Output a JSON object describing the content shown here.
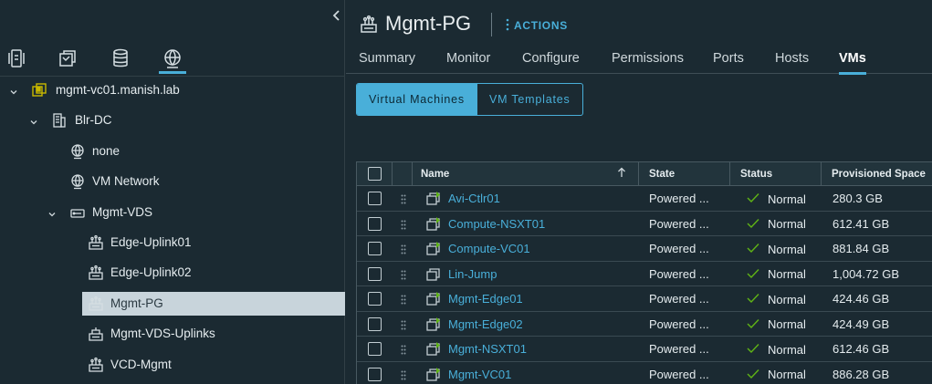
{
  "navigator": {
    "collapse_icon": "chevron-left-icon",
    "view_icons": [
      "hosts-clusters-icon",
      "vms-templates-icon",
      "storage-icon",
      "networking-icon"
    ],
    "active_view": "networking-icon",
    "tree": [
      {
        "label": "mgmt-vc01.manish.lab",
        "icon": "vcenter-icon",
        "expanded": true
      },
      {
        "label": "Blr-DC",
        "icon": "datacenter-icon",
        "expanded": true
      },
      {
        "label": "none",
        "icon": "network-icon"
      },
      {
        "label": "VM Network",
        "icon": "network-icon"
      },
      {
        "label": "Mgmt-VDS",
        "icon": "vds-icon",
        "expanded": true
      },
      {
        "label": "Edge-Uplink01",
        "icon": "portgroup-icon"
      },
      {
        "label": "Edge-Uplink02",
        "icon": "portgroup-icon"
      },
      {
        "label": "Mgmt-PG",
        "icon": "portgroup-icon",
        "selected": true
      },
      {
        "label": "Mgmt-VDS-Uplinks",
        "icon": "uplink-portgroup-icon"
      },
      {
        "label": "VCD-Mgmt",
        "icon": "portgroup-icon"
      }
    ]
  },
  "header": {
    "title": "Mgmt-PG",
    "actions_label": "ACTIONS"
  },
  "tabs": [
    {
      "label": "Summary"
    },
    {
      "label": "Monitor"
    },
    {
      "label": "Configure"
    },
    {
      "label": "Permissions"
    },
    {
      "label": "Ports"
    },
    {
      "label": "Hosts"
    },
    {
      "label": "VMs",
      "active": true
    }
  ],
  "segment": {
    "selected": "Virtual Machines",
    "other": "VM Templates"
  },
  "grid": {
    "columns": {
      "name": "Name",
      "state": "State",
      "status": "Status",
      "space": "Provisioned Space"
    },
    "sort_icon": "arrow-up-icon",
    "rows": [
      {
        "name": "Avi-Ctlr01",
        "state": "Powered ...",
        "status": "Normal",
        "space": "280.3 GB",
        "powered_on": true
      },
      {
        "name": "Compute-NSXT01",
        "state": "Powered ...",
        "status": "Normal",
        "space": "612.41 GB",
        "powered_on": true
      },
      {
        "name": "Compute-VC01",
        "state": "Powered ...",
        "status": "Normal",
        "space": "881.84 GB",
        "powered_on": true
      },
      {
        "name": "Lin-Jump",
        "state": "Powered ...",
        "status": "Normal",
        "space": "1,004.72 GB",
        "powered_on": false
      },
      {
        "name": "Mgmt-Edge01",
        "state": "Powered ...",
        "status": "Normal",
        "space": "424.46 GB",
        "powered_on": true
      },
      {
        "name": "Mgmt-Edge02",
        "state": "Powered ...",
        "status": "Normal",
        "space": "424.49 GB",
        "powered_on": true
      },
      {
        "name": "Mgmt-NSXT01",
        "state": "Powered ...",
        "status": "Normal",
        "space": "612.46 GB",
        "powered_on": true
      },
      {
        "name": "Mgmt-VC01",
        "state": "Powered ...",
        "status": "Normal",
        "space": "886.28 GB",
        "powered_on": true
      }
    ]
  },
  "colors": {
    "background": "#1b2a32",
    "accent": "#49afd9",
    "selected_row": "#c8d4db",
    "status_ok": "#60b515"
  }
}
